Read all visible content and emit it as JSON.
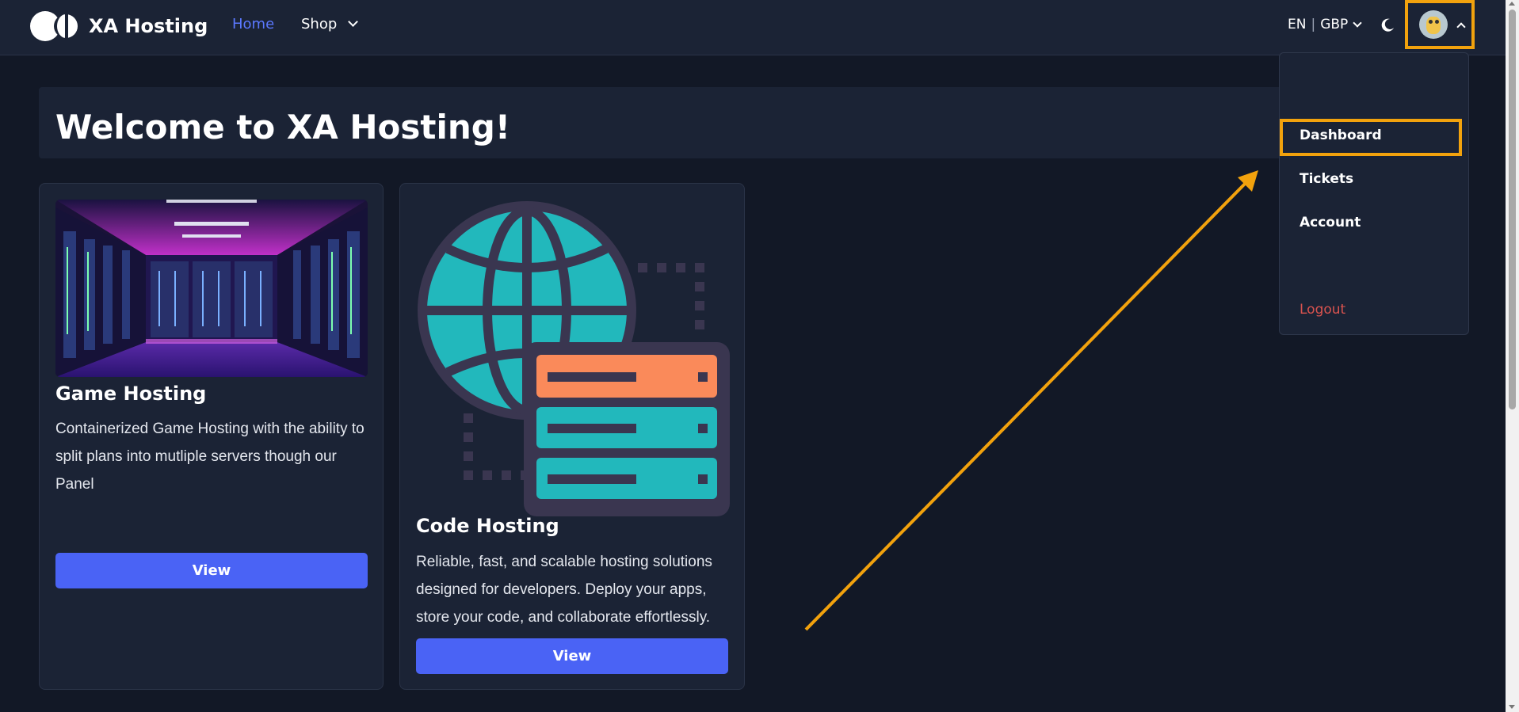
{
  "navbar": {
    "brand_name": "XA Hosting",
    "logo_icon": "xa-logo-icon",
    "links": [
      {
        "label": "Home",
        "active": true
      },
      {
        "label": "Shop",
        "active": false
      }
    ],
    "locale": {
      "language": "EN",
      "separator": "|",
      "currency": "GBP"
    },
    "theme_icon": "moon-icon",
    "avatar_icon": "user-avatar"
  },
  "welcome": {
    "title": "Welcome to XA Hosting!"
  },
  "cards": [
    {
      "title": "Game Hosting",
      "description": "Containerized Game Hosting with the ability to split plans into mutliple servers though our Panel",
      "button_label": "View",
      "image": "server-room-image"
    },
    {
      "title": "Code Hosting",
      "description": "Reliable, fast, and scalable hosting solutions designed for developers. Deploy your apps, store your code, and collaborate effortlessly.",
      "button_label": "View",
      "image": "globe-server-icon"
    }
  ],
  "user_menu": {
    "items": [
      {
        "label": "Dashboard",
        "highlighted": true
      },
      {
        "label": "Tickets"
      },
      {
        "label": "Account"
      },
      {
        "label": "Logout"
      }
    ]
  },
  "colors": {
    "background": "#121826",
    "surface": "#1b2335",
    "accent": "#4a63f5",
    "active_link": "#5b78ff",
    "highlight": "#f2a20d",
    "logout": "#d9534f",
    "globe": "#22b8bc",
    "server_orange": "#fa8a5a"
  }
}
